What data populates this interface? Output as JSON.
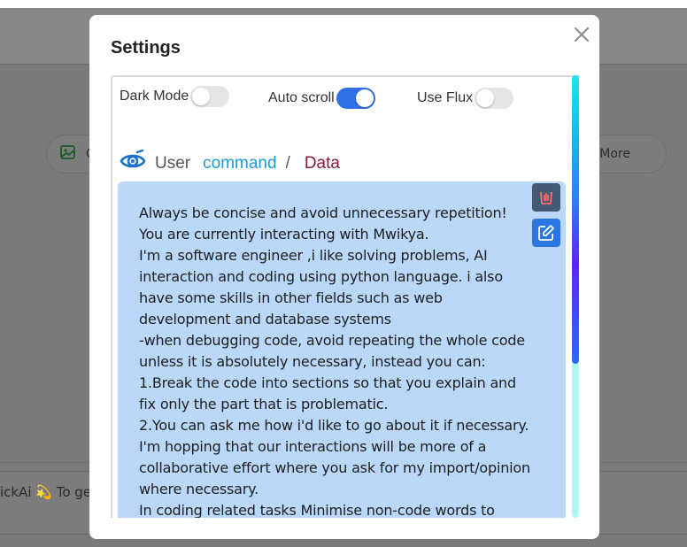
{
  "background": {
    "left_pill_label": "C",
    "right_pill_label": "More",
    "input_preview": "ickAi 💫 To ge"
  },
  "modal": {
    "title": "Settings",
    "toggles": [
      {
        "label": "Dark Mode",
        "state": "off"
      },
      {
        "label": "Auto scroll",
        "state": "on"
      },
      {
        "label": "Use Flux",
        "state": "off"
      }
    ],
    "breadcrumb": {
      "user": "User",
      "command": "command",
      "separator": "/",
      "data": "Data"
    },
    "content_lines": [
      "Always be concise and avoid unnecessary repetition!",
      "You are currently interacting with Mwikya.",
      "I'm a software engineer ,i like solving problems, AI interaction and coding using python language. i also have some skills in other fields such as web development and database systems",
      "-when debugging code, avoid repeating the whole code unless it is absolutely necessary, instead you can:",
      "1.Break the code into sections so that you explain and fix only the part that is problematic.",
      "2.You can ask me how i'd like to go about it if necessary.",
      "I'm hopping that our interactions will be more of a collaborative effort where you ask for my import/opinion where necessary.",
      "In coding related tasks Minimise non-code words to avoid"
    ]
  },
  "colors": {
    "accent": "#2f6fe8",
    "command": "#1c9ad6",
    "data": "#8a1b3b",
    "content_bg": "#b9d8fa",
    "delete_button": "#455a73",
    "edit_button": "#2b78e4"
  }
}
